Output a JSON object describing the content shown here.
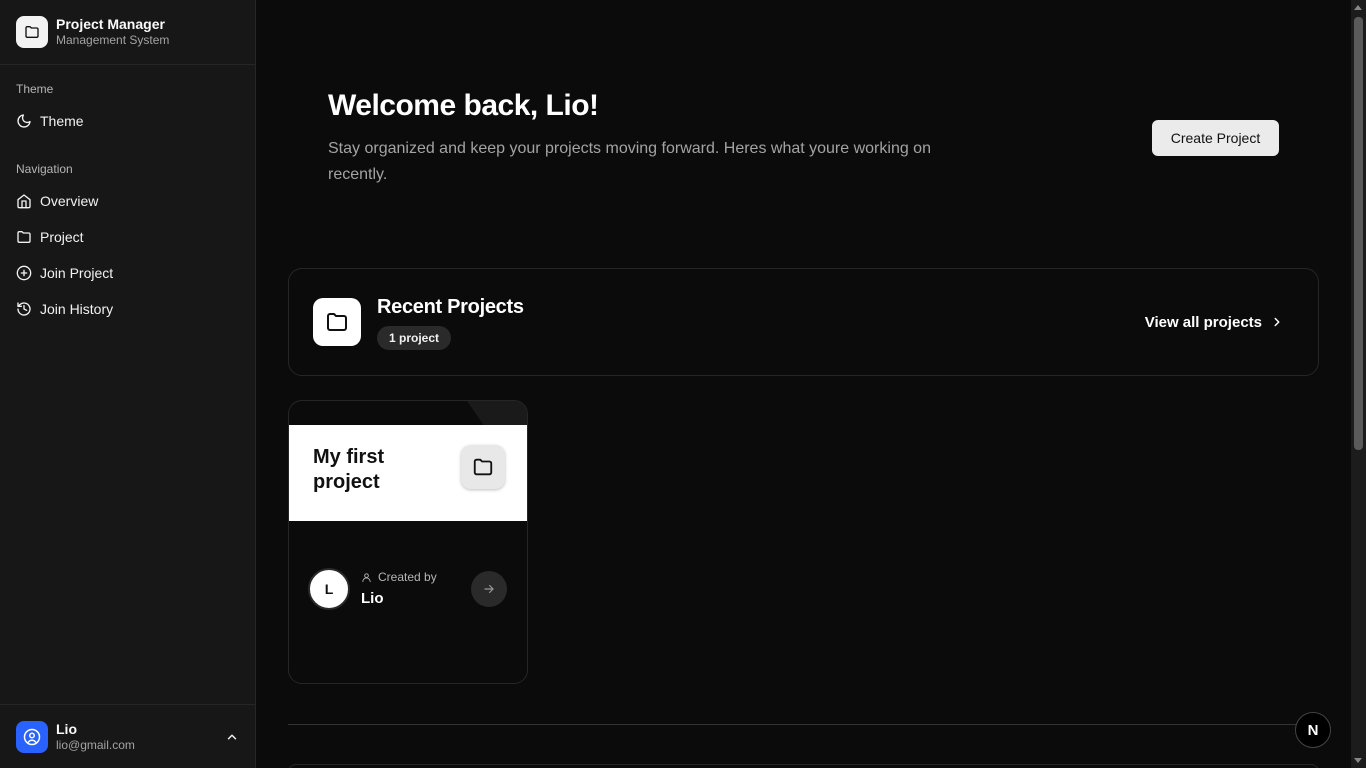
{
  "brand": {
    "title": "Project Manager",
    "subtitle": "Management System",
    "icon": "folder-icon"
  },
  "sidebar": {
    "theme_group": {
      "label": "Theme",
      "items": [
        {
          "label": "Theme",
          "icon": "moon-icon"
        }
      ]
    },
    "nav_group": {
      "label": "Navigation",
      "items": [
        {
          "label": "Overview",
          "icon": "home-icon"
        },
        {
          "label": "Project",
          "icon": "folder-icon"
        },
        {
          "label": "Join Project",
          "icon": "plus-circle-icon"
        },
        {
          "label": "Join History",
          "icon": "history-icon"
        }
      ]
    },
    "user": {
      "name": "Lio",
      "email": "lio@gmail.com",
      "icon": "user-circle-icon"
    }
  },
  "main": {
    "welcome_title": "Welcome back, Lio!",
    "welcome_text": "Stay organized and keep your projects moving forward. Heres what youre working on recently.",
    "create_button": "Create Project",
    "recent": {
      "title": "Recent Projects",
      "badge": "1 project",
      "view_all": "View all projects"
    },
    "projects": [
      {
        "title": "My first project",
        "created_by_label": "Created by",
        "creator": "Lio",
        "avatar_initial": "L"
      }
    ],
    "dev_badge": "N"
  },
  "colors": {
    "background": "#0b0b0b",
    "sidebar": "#171717",
    "user_avatar": "#2962ff",
    "card_head": "#ffffff"
  }
}
